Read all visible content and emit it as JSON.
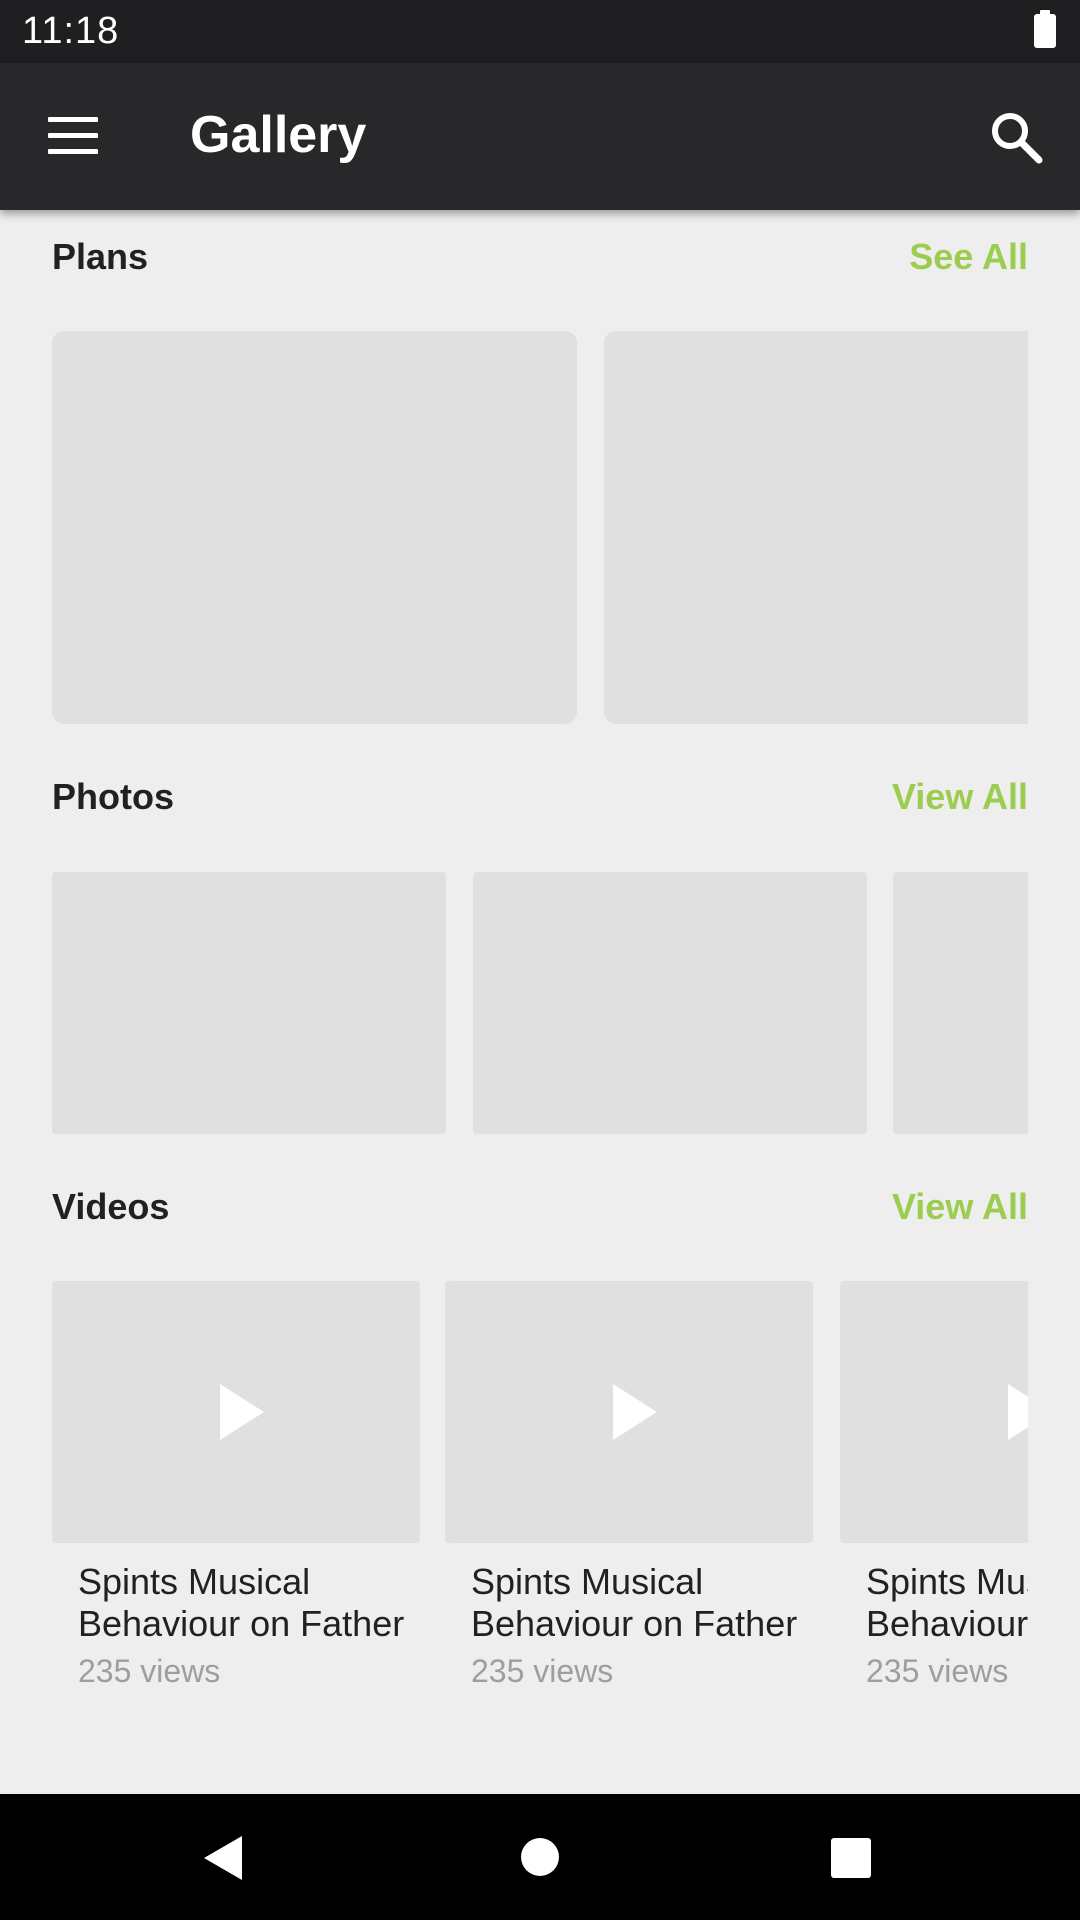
{
  "status_bar": {
    "time": "11:18",
    "battery_icon": "battery-full-icon"
  },
  "app_bar": {
    "menu_icon": "hamburger-menu-icon",
    "title": "Gallery",
    "search_icon": "search-icon"
  },
  "sections": {
    "plans": {
      "title": "Plans",
      "link_label": "See All",
      "card_count": 2
    },
    "photos": {
      "title": "Photos",
      "link_label": "View All",
      "card_count": 3
    },
    "videos": {
      "title": "Videos",
      "link_label": "View All",
      "items": [
        {
          "title": "Spints Musical Behaviour on Father",
          "views": "235 views"
        },
        {
          "title": "Spints Musical Behaviour on Father",
          "views": "235 views"
        },
        {
          "title": "Spints Musical Behaviour on Father",
          "views": "235 views"
        }
      ]
    }
  },
  "nav_bar": {
    "back_icon": "back-triangle-icon",
    "home_icon": "home-circle-icon",
    "recents_icon": "recents-square-icon"
  },
  "colors": {
    "accent": "#9ccc50",
    "app_bar": "#28282a",
    "background": "#eeeeee",
    "placeholder": "#e0e0e0"
  }
}
